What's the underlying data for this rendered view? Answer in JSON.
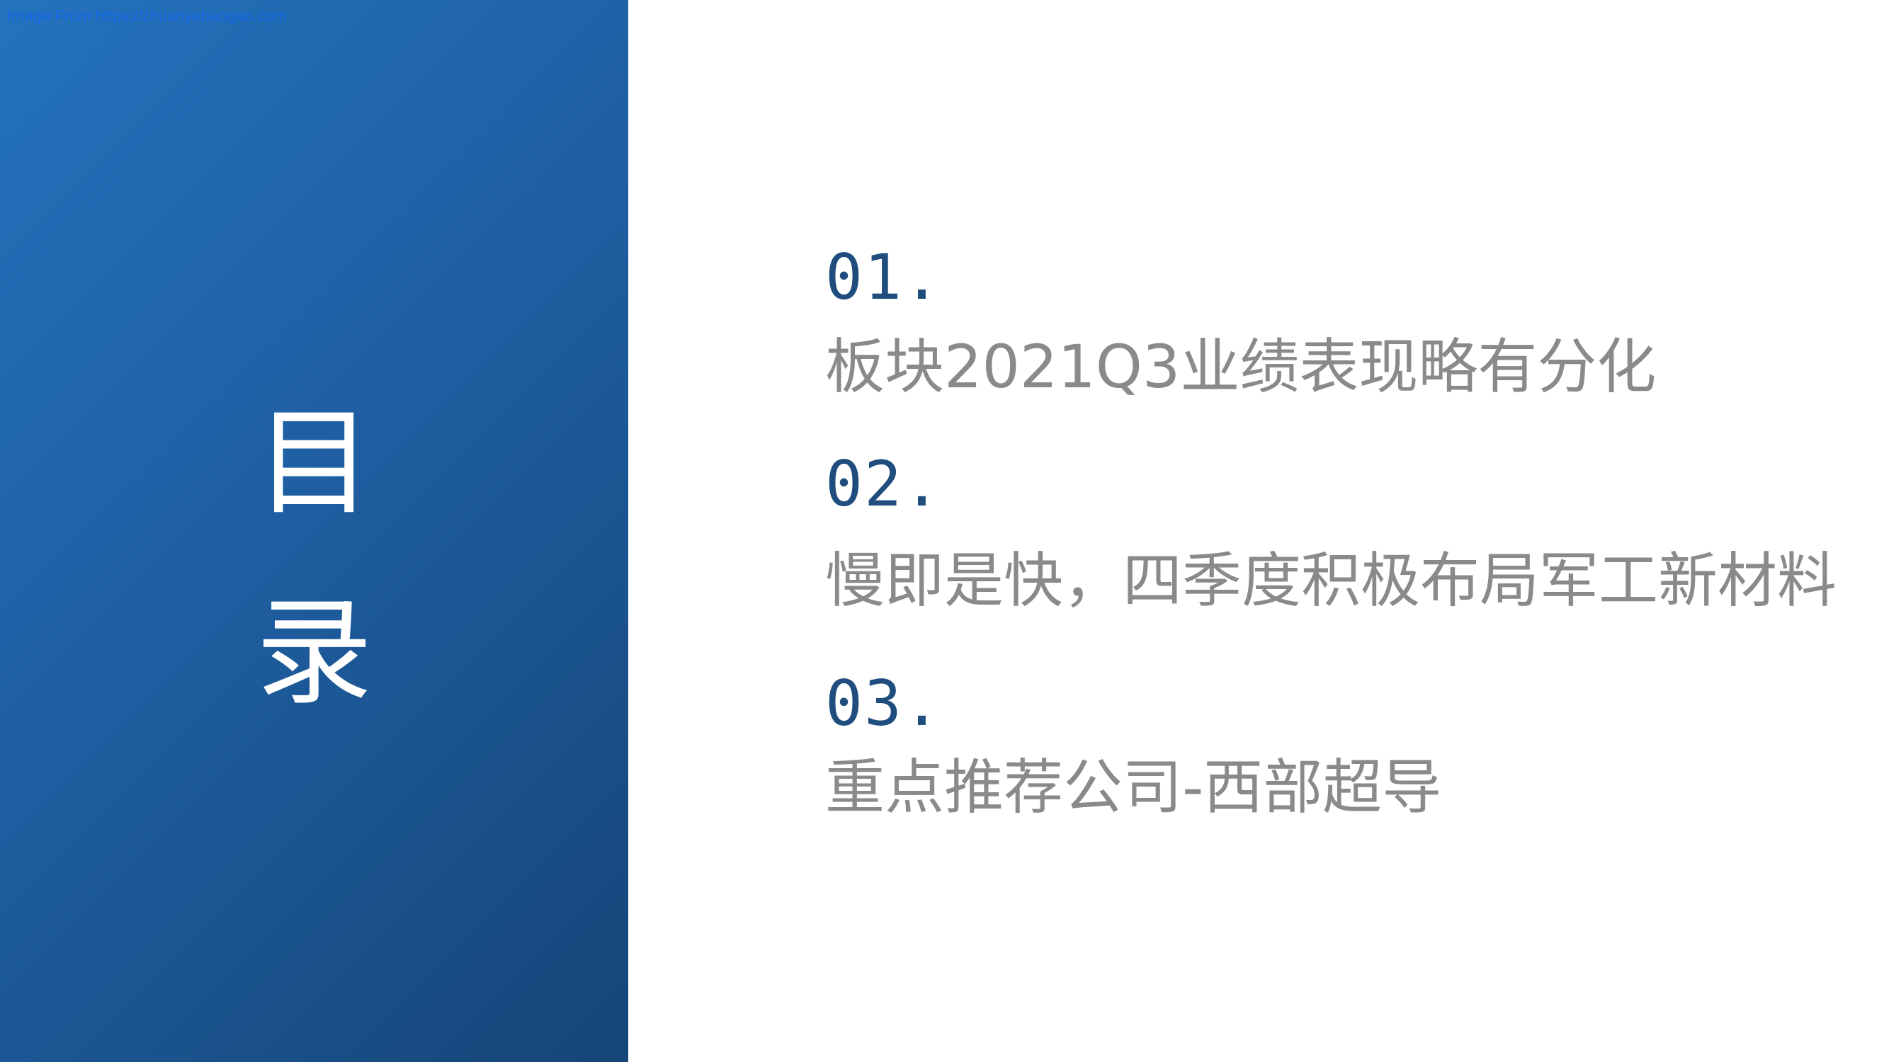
{
  "watermark": "Image From https://zhuanyebaogao.com",
  "title": {
    "char1": "目",
    "char2": "录"
  },
  "items": [
    {
      "number": "01.",
      "text": "板块2021Q3业绩表现略有分化"
    },
    {
      "number": "02.",
      "text": "慢即是快，四季度积极布局军工新材料"
    },
    {
      "number": "03.",
      "text": "重点推荐公司-西部超导"
    }
  ],
  "colors": {
    "panel_gradient_start": "#2472bd",
    "panel_gradient_end": "#154577",
    "number_color": "#1f4d7d",
    "text_color": "#8a8a8a",
    "watermark_color": "#1467e6"
  }
}
